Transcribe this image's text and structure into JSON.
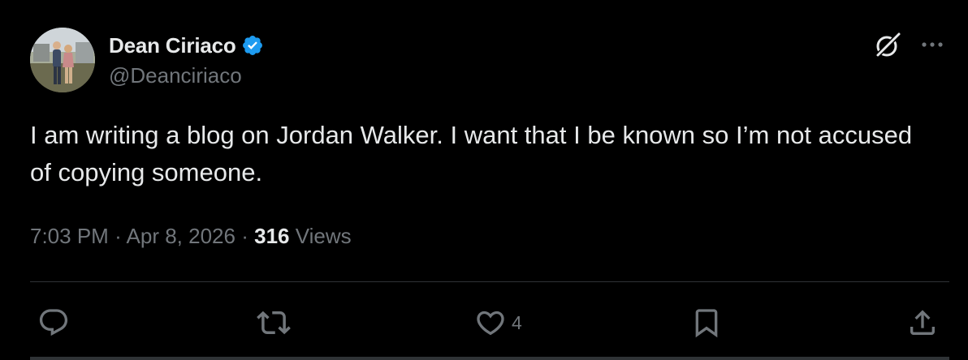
{
  "author": {
    "display_name": "Dean Ciriaco",
    "handle": "@Deanciriaco",
    "verified": true,
    "verified_color": "#1d9bf0"
  },
  "tweet": {
    "text": "I am writing a blog on Jordan Walker. I want that I be known so I’m not accused of copying someone.",
    "time": "7:03 PM",
    "separator": "·",
    "date": "Apr 8, 2026",
    "views_count": "316",
    "views_label": "Views"
  },
  "actions": {
    "reply": {
      "icon": "reply-icon",
      "count": ""
    },
    "retweet": {
      "icon": "retweet-icon",
      "count": ""
    },
    "like": {
      "icon": "heart-icon",
      "count": "4"
    },
    "bookmark": {
      "icon": "bookmark-icon",
      "count": ""
    },
    "share": {
      "icon": "share-icon",
      "count": ""
    }
  },
  "header_icons": {
    "grok": "grok-icon",
    "more": "more-icon"
  },
  "colors": {
    "background": "#000000",
    "primary_text": "#e7e9ea",
    "secondary_text": "#71767b",
    "divider": "#2f3336"
  }
}
